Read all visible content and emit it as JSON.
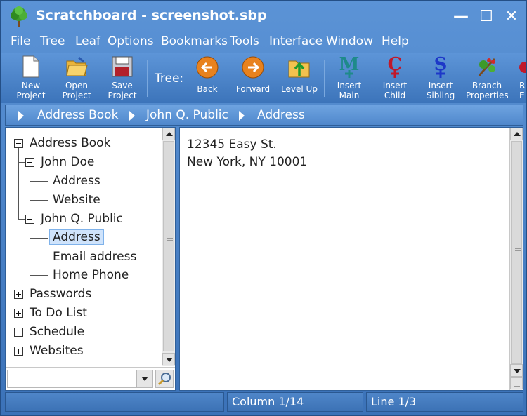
{
  "window": {
    "title": "Scratchboard - screenshot.sbp",
    "controls": {
      "minimize": "—",
      "maximize": "☐",
      "close": "✕"
    }
  },
  "menu": [
    {
      "label": "File"
    },
    {
      "label": "Tree"
    },
    {
      "label": "Leaf"
    },
    {
      "label": "Options"
    },
    {
      "label": "Bookmarks"
    },
    {
      "label": "Tools"
    },
    {
      "label": "Interface"
    },
    {
      "label": "Window"
    },
    {
      "label": "Help"
    }
  ],
  "toolbar": {
    "tree_label": "Tree:",
    "buttons": [
      {
        "line1": "New",
        "line2": "Project",
        "icon": "new-document-icon"
      },
      {
        "line1": "Open",
        "line2": "Project",
        "icon": "open-folder-icon"
      },
      {
        "line1": "Save",
        "line2": "Project",
        "icon": "floppy-disk-icon"
      },
      {
        "line1": "Back",
        "icon": "back-arrow-icon"
      },
      {
        "line1": "Forward",
        "icon": "forward-arrow-icon"
      },
      {
        "line1": "Level Up",
        "icon": "level-up-folder-icon"
      },
      {
        "line1": "Insert",
        "line2": "Main",
        "icon": "insert-main-icon"
      },
      {
        "line1": "Insert",
        "line2": "Child",
        "icon": "insert-child-icon"
      },
      {
        "line1": "Insert",
        "line2": "Sibling",
        "icon": "insert-sibling-icon"
      },
      {
        "line1": "Branch",
        "line2": "Properties",
        "icon": "branch-properties-icon"
      },
      {
        "line1": "R",
        "line2": "E",
        "icon": "truncated-button-icon"
      }
    ]
  },
  "breadcrumb": [
    "Address Book",
    "John Q. Public",
    "Address"
  ],
  "tree": {
    "nodes": [
      {
        "label": "Address Book",
        "expander": "minus"
      },
      {
        "label": "John Doe",
        "expander": "minus"
      },
      {
        "label": "Address"
      },
      {
        "label": "Website"
      },
      {
        "label": "John Q. Public",
        "expander": "minus"
      },
      {
        "label": "Address",
        "selected": true
      },
      {
        "label": "Email address"
      },
      {
        "label": "Home Phone"
      },
      {
        "label": "Passwords",
        "expander": "plus"
      },
      {
        "label": "To Do List",
        "expander": "plus"
      },
      {
        "label": "Schedule",
        "expander": "empty"
      },
      {
        "label": "Websites",
        "expander": "plus"
      }
    ]
  },
  "search": {
    "value": ""
  },
  "content": {
    "text": "12345 Easy St.\nNew York, NY 10001"
  },
  "status": {
    "cell1": "",
    "column": "Column 1/14",
    "line": "Line 1/3"
  }
}
